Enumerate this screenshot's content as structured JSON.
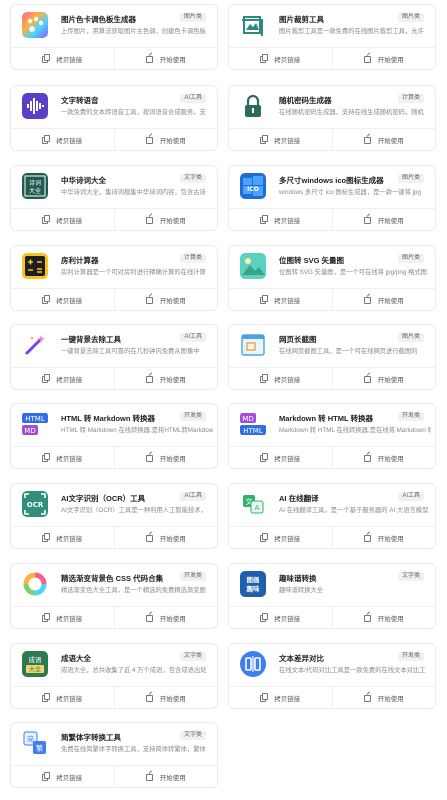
{
  "common": {
    "copy_label": "拷贝链接",
    "open_label": "开始使用"
  },
  "tools": [
    {
      "title": "图片色卡调色板生成器",
      "badge": "图片类",
      "desc": "上传图片，用算法获取图片主色调，创建色卡调色板",
      "icon": "palette-icon"
    },
    {
      "title": "图片裁剪工具",
      "badge": "图片类",
      "desc": "图片裁剪工具是一款免费的在线图片裁剪工具，允许",
      "icon": "crop-image-icon"
    },
    {
      "title": "文字转语音",
      "badge": "AI工具",
      "desc": "一款免费的文本转语音工具，按词语音合成服务，支",
      "icon": "soundwave-icon"
    },
    {
      "title": "随机密码生成器",
      "badge": "计算类",
      "desc": "在线随机密码生成器，支持在线生成随机密码，随机",
      "icon": "lock-icon"
    },
    {
      "title": "中华诗词大全",
      "badge": "文字类",
      "desc": "中华诗词大全，集诗词搜集中华诗词内容，包含古诗",
      "icon": "poetry-book-icon"
    },
    {
      "title": "多尺寸windows ico图标生成器",
      "badge": "图片类",
      "desc": "windows 多尺寸 ico 图标生成器，是一款一键将 jpg",
      "icon": "ico-icon"
    },
    {
      "title": "房利计算器",
      "badge": "计算类",
      "desc": "房利计算器是一个可对房利进行精确计算的在线计算",
      "icon": "calculator-icon"
    },
    {
      "title": "位图转 SVG 矢量图",
      "badge": "图片类",
      "desc": "位图转 SVG 矢量图，是一个可在线将 jpg/png 格式图",
      "icon": "landscape-image-icon"
    },
    {
      "title": "一键背景去除工具",
      "badge": "AI工具",
      "desc": "一键背景去除工具可靠的在几秒钟内免费从图像中",
      "icon": "magic-wand-icon"
    },
    {
      "title": "网页长截图",
      "badge": "图片类",
      "desc": "在线网页截图工具，是一个可在线网页进行截图的",
      "icon": "screenshot-icon"
    },
    {
      "title": "HTML 转 Markdown 转换器",
      "badge": "开发类",
      "desc": "HTML 转 Markdown 在线转换器,是将HTML转Markdown",
      "icon": "html-to-md-icon"
    },
    {
      "title": "Markdown 转 HTML 转换器",
      "badge": "开发类",
      "desc": "Markdown 转 HTML 在线转换器,是在线将 Markdown 转",
      "icon": "md-to-html-icon"
    },
    {
      "title": "AI文字识别（OCR）工具",
      "badge": "AI工具",
      "desc": "AI文字识别（OCR）工具是一种利用人工智能技术，",
      "icon": "ocr-icon"
    },
    {
      "title": "AI 在线翻译",
      "badge": "AI工具",
      "desc": "AI 在线翻译工具，是一个基于服务器的 AI 大语言模型",
      "icon": "translate-icon"
    },
    {
      "title": "精选渐变背景色 CSS 代码合集",
      "badge": "开发类",
      "desc": "精选渐变色大全工具，是一个精选的免费精选渐变图",
      "icon": "gradient-ring-icon"
    },
    {
      "title": "趣味谐转换",
      "badge": "文字类",
      "desc": "趣味谐转换大全",
      "icon": "fun-text-icon"
    },
    {
      "title": "成语大全",
      "badge": "文字类",
      "desc": "成语大全，总共收集了近 4 万个成语，包含成语出处",
      "icon": "idiom-book-icon"
    },
    {
      "title": "文本差异对比",
      "badge": "开发类",
      "desc": "在线文本/代码对比工具是一款免费的在线文本对比工",
      "icon": "diff-icon"
    },
    {
      "title": "简繁体字转换工具",
      "badge": "文字类",
      "desc": "免费在线简繁体字转换工具，支持简体转繁体，繁体",
      "icon": "simp-trad-icon"
    }
  ]
}
